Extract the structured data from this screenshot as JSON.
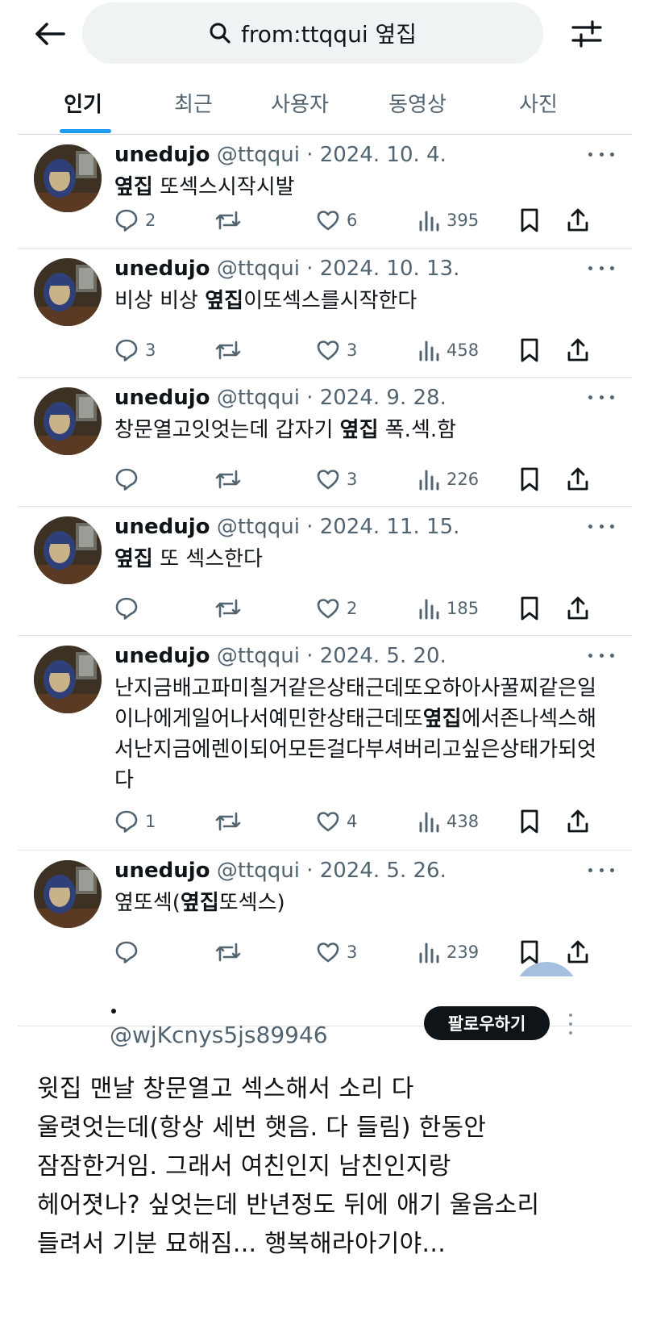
{
  "header": {
    "search_query": "from:ttqqui 옆집"
  },
  "tabs": [
    {
      "label": "인기",
      "active": true
    },
    {
      "label": "최근"
    },
    {
      "label": "사용자"
    },
    {
      "label": "동영상"
    },
    {
      "label": "사진"
    }
  ],
  "tweets": [
    {
      "name": "unedujo",
      "meta": "@ttqqui · 2024. 10. 4.",
      "body_html": "<b>옆집</b> 또섹스시작시발",
      "replies": "2",
      "likes": "6",
      "views": "395"
    },
    {
      "name": "unedujo",
      "meta": "@ttqqui · 2024. 10. 13.",
      "body_html": "비상 비상 <b>옆집</b>이또섹스를시작한다",
      "replies": "3",
      "likes": "3",
      "views": "458"
    },
    {
      "name": "unedujo",
      "meta": "@ttqqui · 2024. 9. 28.",
      "body_html": "창문열고잇엇는데 갑자기 <b>옆집</b> 폭.섹.함",
      "replies": "",
      "likes": "3",
      "views": "226"
    },
    {
      "name": "unedujo",
      "meta": "@ttqqui · 2024. 11. 15.",
      "body_html": "<b>옆집</b> 또 섹스한다",
      "replies": "",
      "likes": "2",
      "views": "185"
    },
    {
      "name": "unedujo",
      "meta": "@ttqqui · 2024. 5. 20.",
      "body_html": "난지금배고파미칠거같은상태근데또오하아사꿀찌같은일이나에게일어나서예민한상태근데또<b>옆집</b>에서존나섹스해서난지금에렌이되어모든걸다부셔버리고싶은상태가되엇다",
      "replies": "1",
      "likes": "4",
      "views": "438"
    },
    {
      "name": "unedujo",
      "meta": "@ttqqui · 2024. 5. 26.",
      "body_html": "옆또섹(<b>옆집</b>또섹스)",
      "replies": "",
      "likes": "3",
      "views": "239"
    }
  ],
  "post": {
    "handle": "@wjKcnys5js89946",
    "follow_label": "팔로우하기",
    "caption_lines": [
      "윗집 맨날 창문열고 섹스해서 소리 다",
      "울렷엇는데(항상 세번 햇음. 다 들림) 한동안",
      "잠잠한거임. 그래서 여친인지 남친인지랑",
      "헤어졋나? 싶엇는데 반년정도 뒤에 애기 울음소리",
      "들려서 기분 묘해짐... 행복해라아기야..."
    ]
  },
  "icons": {
    "back": "arrow-left-icon",
    "search": "search-icon",
    "filter": "sliders-icon",
    "reply": "reply-icon",
    "retweet": "retweet-icon",
    "like": "heart-icon",
    "views": "views-icon",
    "bookmark": "bookmark-icon",
    "share": "share-icon"
  },
  "colors": {
    "accent": "#1d9bf0",
    "text": "#0f1419",
    "muted": "#536471",
    "search_bg": "#eff3f4"
  }
}
